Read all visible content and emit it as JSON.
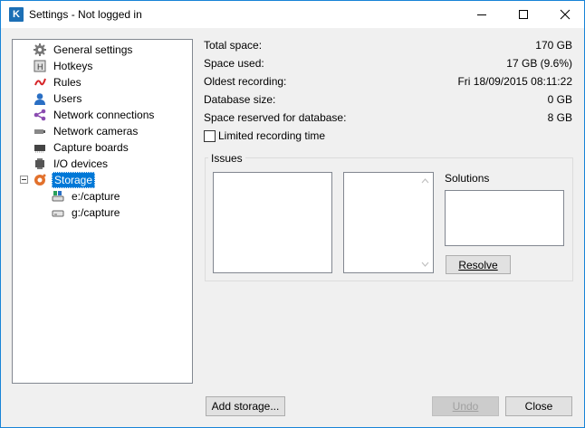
{
  "window": {
    "title": "Settings - Not logged in",
    "icon_letter": "K"
  },
  "tree": {
    "items": [
      {
        "label": "General settings",
        "icon": "gear-icon"
      },
      {
        "label": "Hotkeys",
        "icon": "hotkey-icon"
      },
      {
        "label": "Rules",
        "icon": "rules-icon"
      },
      {
        "label": "Users",
        "icon": "user-icon"
      },
      {
        "label": "Network connections",
        "icon": "network-connections-icon"
      },
      {
        "label": "Network cameras",
        "icon": "network-camera-icon"
      },
      {
        "label": "Capture boards",
        "icon": "capture-board-icon"
      },
      {
        "label": "I/O devices",
        "icon": "io-device-icon"
      },
      {
        "label": "Storage",
        "icon": "storage-icon",
        "selected": true
      },
      {
        "label": "e:/capture",
        "icon": "drive-icon"
      },
      {
        "label": "g:/capture",
        "icon": "drive-icon"
      }
    ]
  },
  "info": {
    "total_space_label": "Total space:",
    "total_space_value": "170 GB",
    "space_used_label": "Space used:",
    "space_used_value": "17 GB (9.6%)",
    "oldest_recording_label": "Oldest recording:",
    "oldest_recording_value": "Fri 18/09/2015 08:11:22",
    "db_size_label": "Database size:",
    "db_size_value": "0 GB",
    "space_reserved_label": "Space reserved for database:",
    "space_reserved_value": "8 GB"
  },
  "limited_recording_label": "Limited recording time",
  "issues": {
    "title": "Issues",
    "solutions_label": "Solutions",
    "resolve_label": "Resolve"
  },
  "buttons": {
    "add_storage": "Add storage...",
    "undo": "Undo",
    "close": "Close"
  },
  "colors": {
    "selection": "#0078d7",
    "accent": "#1883d7"
  }
}
